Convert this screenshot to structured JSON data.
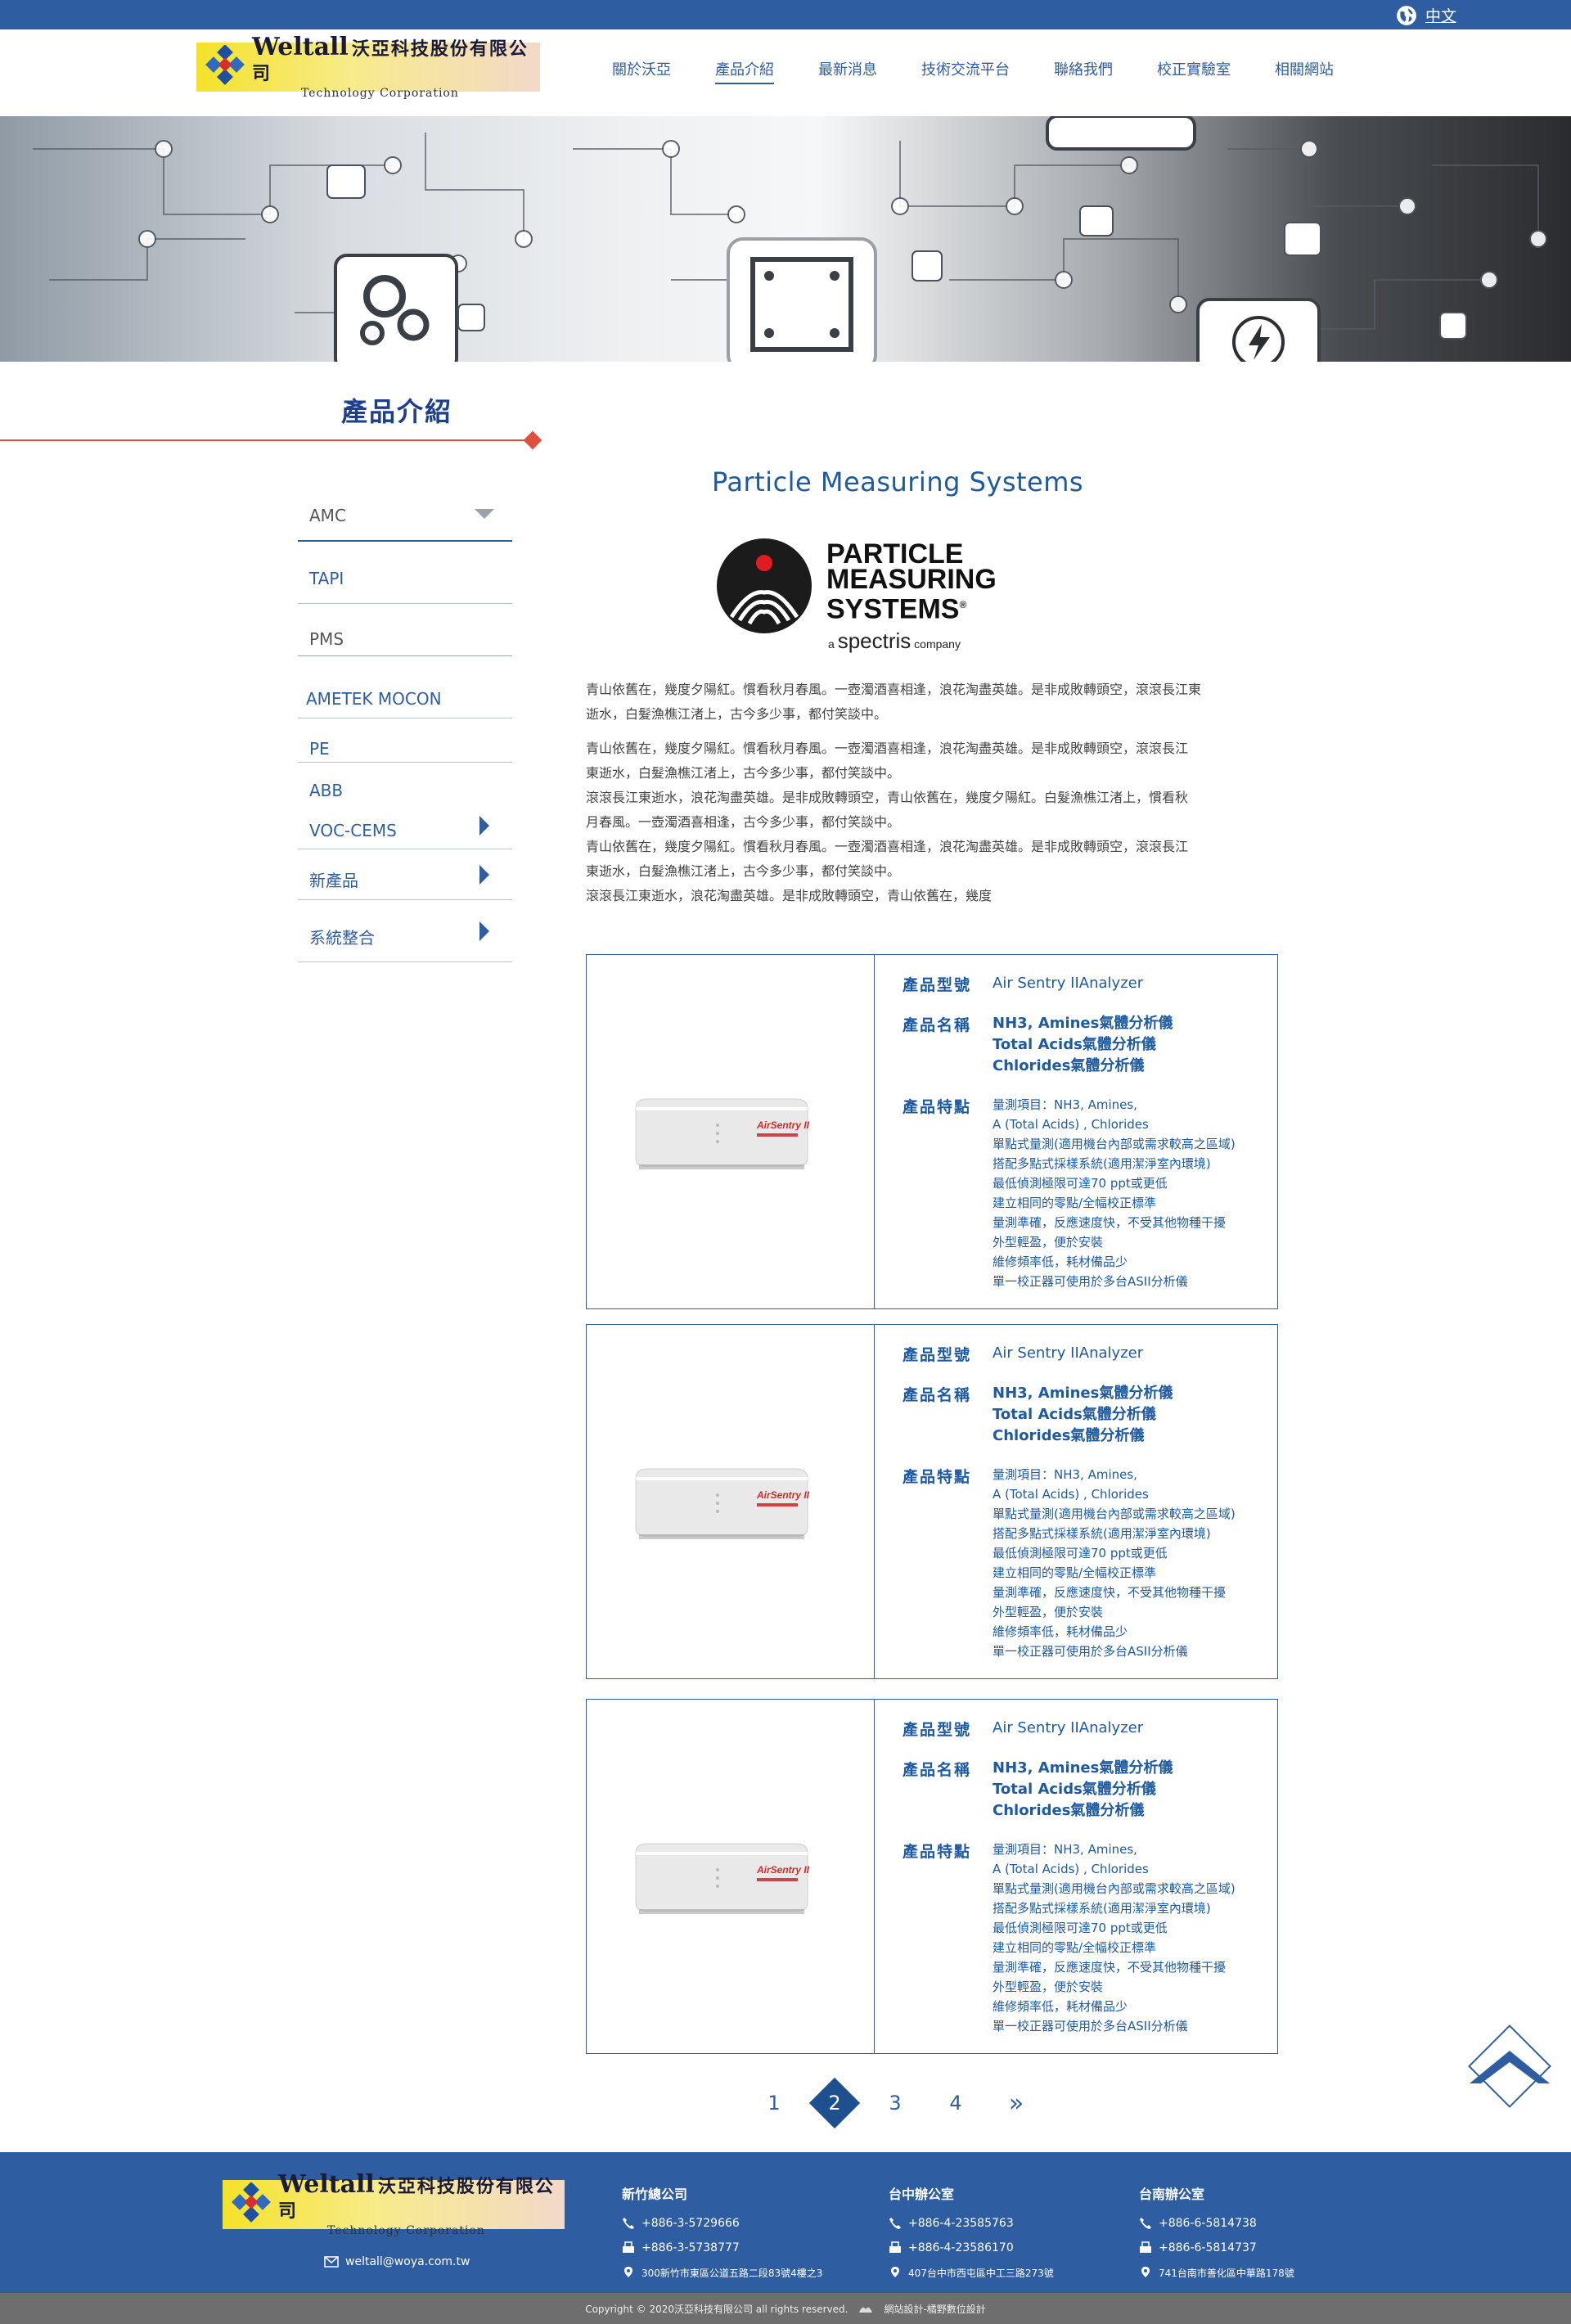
{
  "topbar": {
    "lang_label": "中文"
  },
  "header": {
    "logo_name": "Weltall",
    "logo_cn": "沃亞科技股份有限公司",
    "logo_sub": "Technology Corporation",
    "nav": [
      "關於沃亞",
      "產品介紹",
      "最新消息",
      "技術交流平台",
      "聯絡我們",
      "校正實驗室",
      "相關網站"
    ]
  },
  "sidebar": {
    "title": "產品介紹",
    "items": [
      {
        "label": "AMC"
      },
      {
        "label": "TAPI"
      },
      {
        "label": "PMS"
      },
      {
        "label": "AMETEK MOCON"
      },
      {
        "label": "PE"
      },
      {
        "label": "ABB"
      },
      {
        "label": "VOC-CEMS"
      },
      {
        "label": "新產品"
      },
      {
        "label": "系統整合"
      }
    ]
  },
  "main": {
    "title": "Particle Measuring Systems",
    "brand_logo": {
      "line1": "PARTICLE",
      "line2": "MEASURING",
      "line3": "SYSTEMS",
      "reg": "®",
      "prefix": "a",
      "spectris": "spectris",
      "suffix": "company"
    },
    "intro": [
      [
        "青山依舊在，幾度夕陽紅。慣看秋月春風。一壺濁酒喜相逢，浪花淘盡英雄。是非成敗轉頭空，滾滾長江東",
        "逝水，白髮漁樵江渚上，古今多少事，都付笑談中。"
      ],
      [
        "青山依舊在，幾度夕陽紅。慣看秋月春風。一壺濁酒喜相逢，浪花淘盡英雄。是非成敗轉頭空，滾滾長江",
        "東逝水，白髮漁樵江渚上，古今多少事，都付笑談中。",
        "滾滾長江東逝水，浪花淘盡英雄。是非成敗轉頭空，青山依舊在，幾度夕陽紅。白髮漁樵江渚上，慣看秋",
        "月春風。一壺濁酒喜相逢，古今多少事，都付笑談中。",
        "青山依舊在，幾度夕陽紅。慣看秋月春風。一壺濁酒喜相逢，浪花淘盡英雄。是非成敗轉頭空，滾滾長江",
        "東逝水，白髮漁樵江渚上，古今多少事，都付笑談中。",
        "滾滾長江東逝水，浪花淘盡英雄。是非成敗轉頭空，青山依舊在，幾度"
      ]
    ]
  },
  "products": [
    {
      "model_label": "產品型號",
      "model": "Air Sentry IIAnalyzer",
      "name_label": "產品名稱",
      "names": [
        "NH3, Amines氣體分析儀",
        "Total Acids氣體分析儀",
        "Chlorides氣體分析儀"
      ],
      "feature_label": "產品特點",
      "features": [
        "量測項目：NH3, Amines,",
        "A (Total Acids) , Chlorides",
        "單點式量測(適用機台內部或需求較高之區域)",
        "搭配多點式採樣系統(適用潔淨室內環境)",
        "最低偵測極限可達70 ppt或更低",
        "建立相同的零點/全幅校正標準",
        "量測準確，反應速度快，不受其他物種干擾",
        "外型輕盈，便於安裝",
        "維修頻率低，耗材備品少",
        "單一校正器可使用於多台ASII分析儀"
      ],
      "device_label": "AirSentry II"
    },
    {
      "model_label": "產品型號",
      "model": "Air Sentry IIAnalyzer",
      "name_label": "產品名稱",
      "names": [
        "NH3, Amines氣體分析儀",
        "Total Acids氣體分析儀",
        "Chlorides氣體分析儀"
      ],
      "feature_label": "產品特點",
      "features": [
        "量測項目：NH3, Amines,",
        "A (Total Acids) , Chlorides",
        "單點式量測(適用機台內部或需求較高之區域)",
        "搭配多點式採樣系統(適用潔淨室內環境)",
        "最低偵測極限可達70 ppt或更低",
        "建立相同的零點/全幅校正標準",
        "量測準確，反應速度快，不受其他物種干擾",
        "外型輕盈，便於安裝",
        "維修頻率低，耗材備品少",
        "單一校正器可使用於多台ASII分析儀"
      ],
      "device_label": "AirSentry II"
    },
    {
      "model_label": "產品型號",
      "model": "Air Sentry IIAnalyzer",
      "name_label": "產品名稱",
      "names": [
        "NH3, Amines氣體分析儀",
        "Total Acids氣體分析儀",
        "Chlorides氣體分析儀"
      ],
      "feature_label": "產品特點",
      "features": [
        "量測項目：NH3, Amines,",
        "A (Total Acids) , Chlorides",
        "單點式量測(適用機台內部或需求較高之區域)",
        "搭配多點式採樣系統(適用潔淨室內環境)",
        "最低偵測極限可達70 ppt或更低",
        "建立相同的零點/全幅校正標準",
        "量測準確，反應速度快，不受其他物種干擾",
        "外型輕盈，便於安裝",
        "維修頻率低，耗材備品少",
        "單一校正器可使用於多台ASII分析儀"
      ],
      "device_label": "AirSentry II"
    }
  ],
  "pagination": {
    "pages": [
      "1",
      "2",
      "3",
      "4"
    ],
    "current": "2",
    "next": "»"
  },
  "footer": {
    "email": "weltall@woya.com.tw",
    "offices": [
      {
        "title": "新竹總公司",
        "tel": "+886-3-5729666",
        "fax": "+886-3-5738777",
        "addr": "300新竹市東區公道五路二段83號4樓之3"
      },
      {
        "title": "台中辦公室",
        "tel": "+886-4-23585763",
        "fax": "+886-4-23586170",
        "addr": "407台中市西屯區中工三路273號"
      },
      {
        "title": "台南辦公室",
        "tel": "+886-6-5814738",
        "fax": "+886-6-5814737",
        "addr": "741台南市善化區中華路178號"
      }
    ],
    "copyright": "Copyright © 2020沃亞科技有限公司 all rights reserved.",
    "designer": "網站設計-橘野數位設計"
  },
  "colors": {
    "primary": "#2e5da1",
    "accent": "#e0503e",
    "footer": "#2e5da1",
    "copyright_bar": "#6e6e6e"
  }
}
